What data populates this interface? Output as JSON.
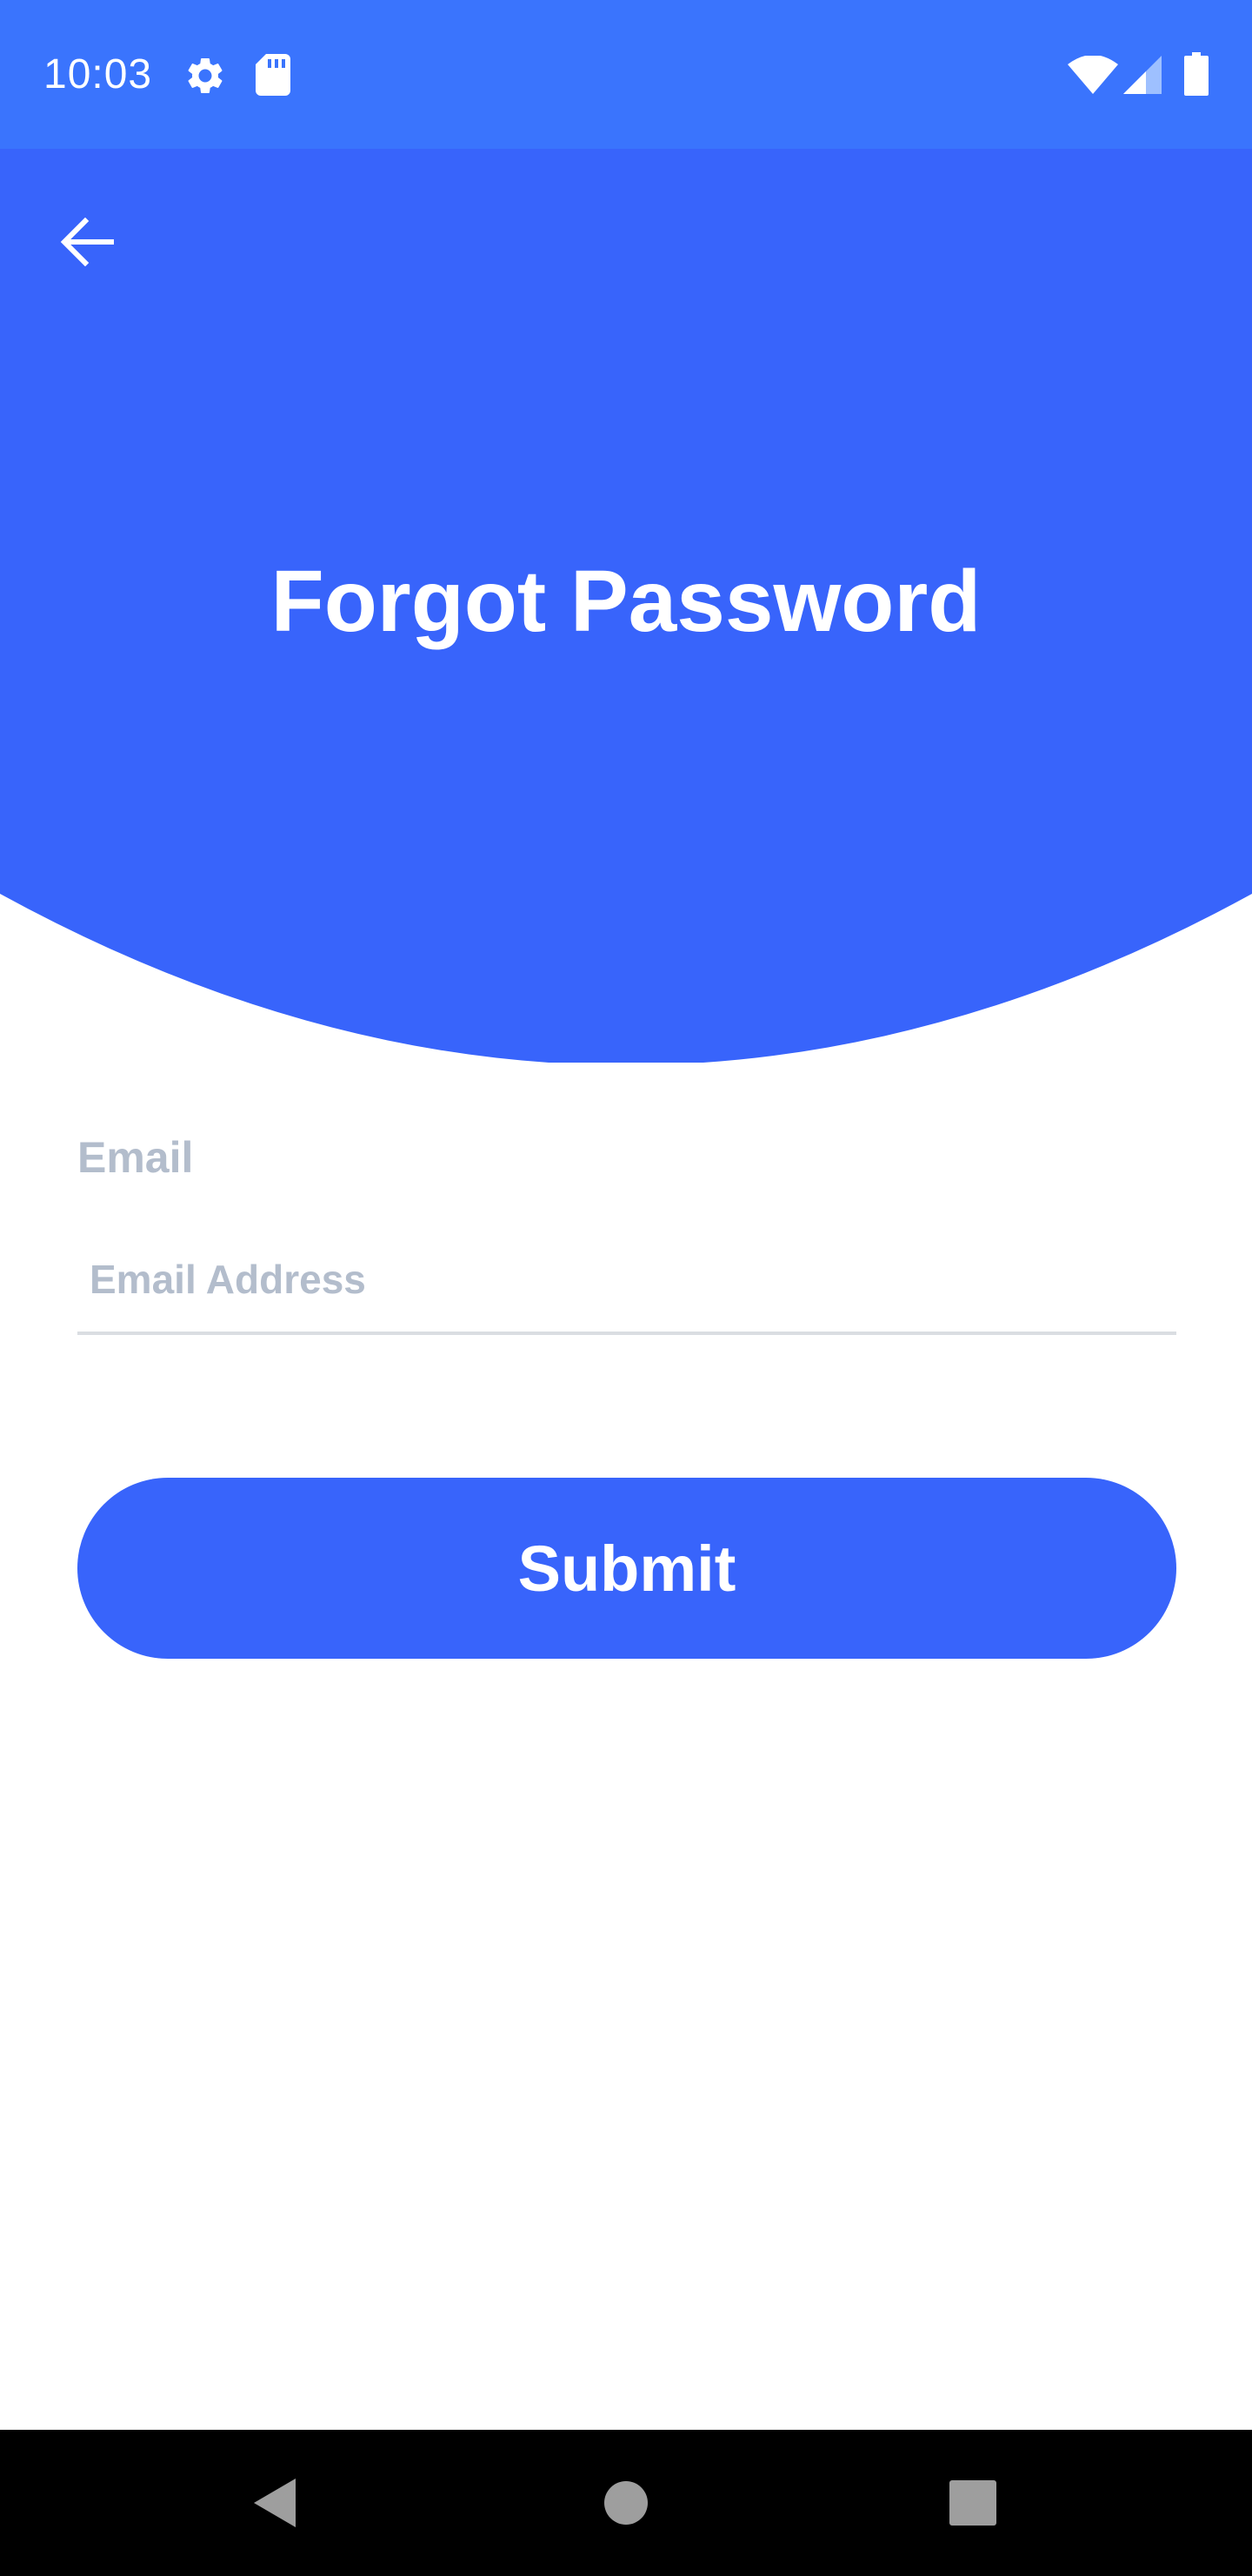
{
  "status_bar": {
    "time": "10:03",
    "icons": [
      "settings-icon",
      "sd-card-icon",
      "wifi-icon",
      "cell-signal-icon",
      "battery-icon"
    ]
  },
  "header": {
    "title": "Forgot Password",
    "back_icon": "arrow-left-icon"
  },
  "form": {
    "email_label": "Email",
    "email_value": "",
    "email_placeholder": "Email Address",
    "submit_label": "Submit"
  },
  "nav_bar": {
    "icons": [
      "back-triangle-icon",
      "home-circle-icon",
      "recents-square-icon"
    ]
  },
  "colors": {
    "status_bar": "#3a74fd",
    "header": "#3864fb",
    "button": "#3864fb",
    "label": "#b3bdcc",
    "underline": "#dadde2",
    "nav_bar": "#000000"
  }
}
